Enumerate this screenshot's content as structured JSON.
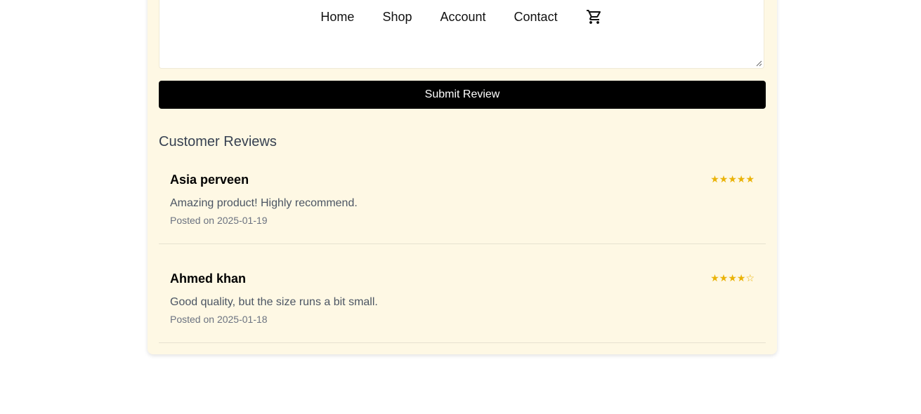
{
  "nav": {
    "items": [
      {
        "label": "Home"
      },
      {
        "label": "Shop"
      },
      {
        "label": "Account"
      },
      {
        "label": "Contact"
      }
    ],
    "cart_icon": "cart-icon"
  },
  "form": {
    "textarea_value": "",
    "submit_label": "Submit Review"
  },
  "reviews": {
    "title": "Customer Reviews",
    "items": [
      {
        "name": "Asia perveen",
        "rating": 5,
        "stars": "★★★★★",
        "text": "Amazing product! Highly recommend.",
        "date": "Posted on 2025-01-19"
      },
      {
        "name": "Ahmed khan",
        "rating": 4,
        "stars": "★★★★☆",
        "text": "Good quality, but the size runs a bit small.",
        "date": "Posted on 2025-01-18"
      }
    ]
  },
  "colors": {
    "card_background": "#fef8e4",
    "button_background": "#000000",
    "star_color": "#eab308"
  }
}
